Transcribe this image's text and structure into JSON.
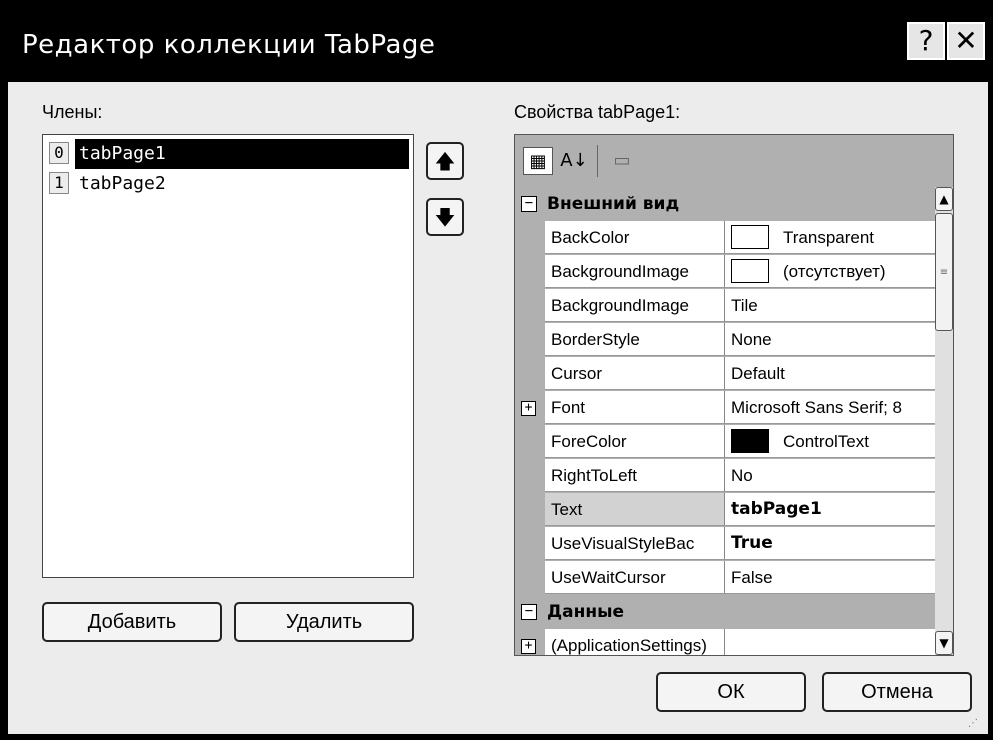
{
  "window": {
    "title": "Редактор коллекции TabPage",
    "help_glyph": "?",
    "close_glyph": "✕"
  },
  "members": {
    "label": "Члены:",
    "items": [
      {
        "index": "0",
        "name": "tabPage1",
        "selected": true
      },
      {
        "index": "1",
        "name": "tabPage2",
        "selected": false
      }
    ],
    "move_up_icon": "arrow-up-icon",
    "move_down_icon": "arrow-down-icon"
  },
  "buttons": {
    "add": "Добавить",
    "remove": "Удалить",
    "ok": "ОК",
    "cancel": "Отмена"
  },
  "properties": {
    "label": "Свойства tabPage1:",
    "toolbar": {
      "categorized_icon": "categorized-icon",
      "alphabetical_icon": "alphabetical-icon",
      "property_pages_icon": "property-pages-icon",
      "alphabetical_glyph": "A↓",
      "categorized_glyph": "▦"
    },
    "categories": [
      {
        "name": "Внешний вид",
        "rows": [
          {
            "name": "BackColor",
            "value": "Transparent",
            "swatch": "#ffffff"
          },
          {
            "name": "BackgroundImage",
            "value": "(отсутствует)",
            "swatch": "#ffffff"
          },
          {
            "name": "BackgroundImage",
            "value": "Tile"
          },
          {
            "name": "BorderStyle",
            "value": "None"
          },
          {
            "name": "Cursor",
            "value": "Default"
          },
          {
            "name": "Font",
            "value": "Microsoft Sans Serif; 8",
            "expandable": true
          },
          {
            "name": "ForeColor",
            "value": "ControlText",
            "swatch": "#000000"
          },
          {
            "name": "RightToLeft",
            "value": "No"
          },
          {
            "name": "Text",
            "value": "tabPage1",
            "bold": true,
            "selected": true
          },
          {
            "name": "UseVisualStyleBac",
            "value": "True",
            "bold": true
          },
          {
            "name": "UseWaitCursor",
            "value": "False"
          }
        ]
      },
      {
        "name": "Данные",
        "rows": [
          {
            "name": "(ApplicationSettings)",
            "value": "",
            "expandable": true
          }
        ]
      }
    ]
  }
}
